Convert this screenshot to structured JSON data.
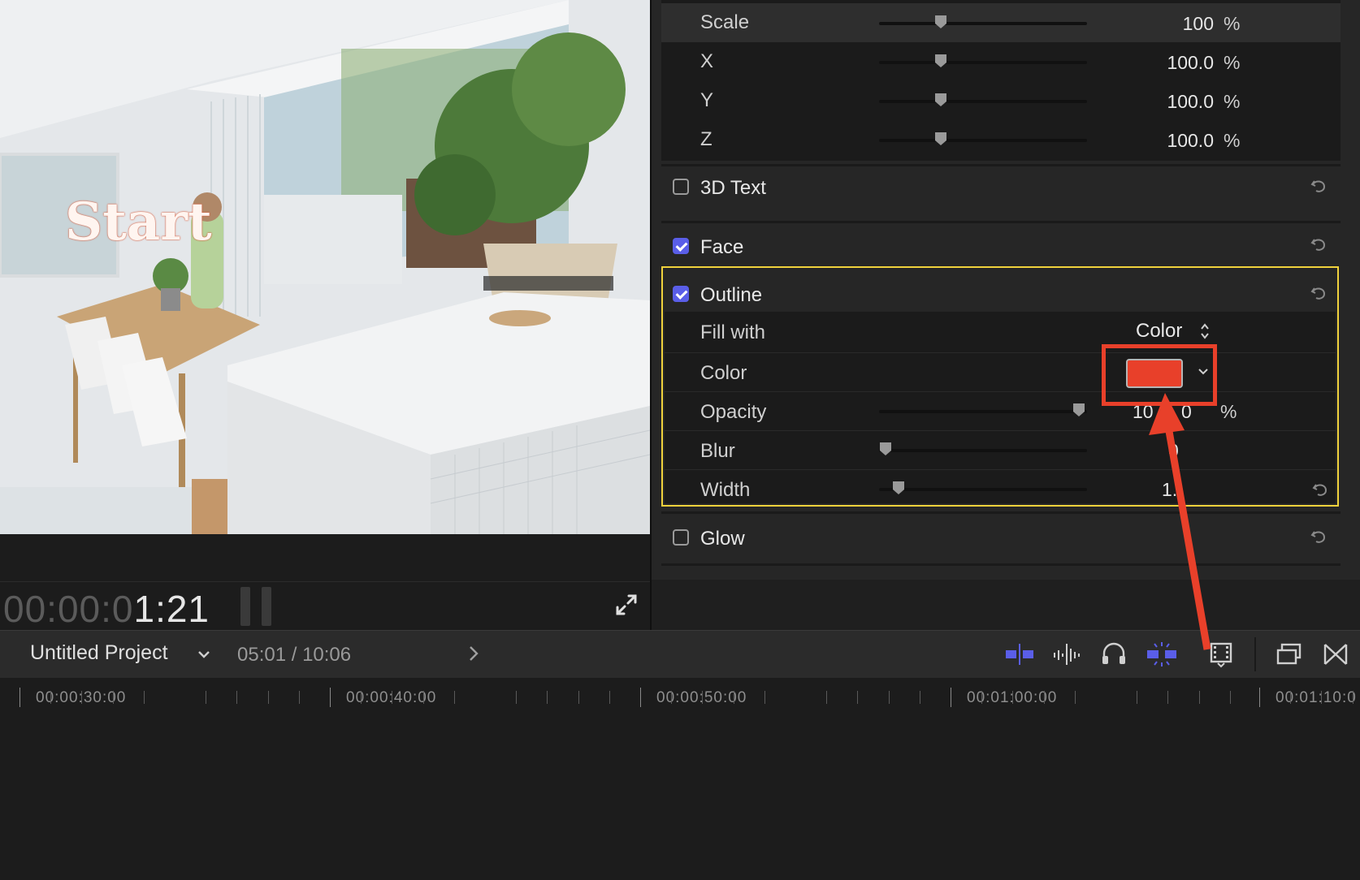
{
  "viewer": {
    "title_overlay": "Start",
    "timecode_dim": "00:00:0",
    "timecode_bright": "1:21"
  },
  "inspector": {
    "scale": {
      "label": "Scale",
      "value": "100",
      "unit": "%",
      "level": 0.27
    },
    "x": {
      "label": "X",
      "value": "100.0",
      "unit": "%",
      "level": 0.27
    },
    "y": {
      "label": "Y",
      "value": "100.0",
      "unit": "%",
      "level": 0.27
    },
    "z": {
      "label": "Z",
      "value": "100.0",
      "unit": "%",
      "level": 0.27
    },
    "text3d": {
      "label": "3D Text",
      "checked": false
    },
    "face": {
      "label": "Face",
      "checked": true
    },
    "outline": {
      "label": "Outline",
      "checked": true,
      "fill_with": {
        "label": "Fill with",
        "value": "Color"
      },
      "color": {
        "label": "Color",
        "swatch": "#e8402a"
      },
      "opacity": {
        "label": "Opacity",
        "value": "10",
        "value_tail": "0",
        "unit": "%",
        "level": 0.97
      },
      "blur": {
        "label": "Blur",
        "value": "0",
        "level": 0.0
      },
      "width": {
        "label": "Width",
        "value": "1.",
        "level": 0.06
      }
    },
    "glow": {
      "label": "Glow",
      "checked": false
    }
  },
  "timeline": {
    "project_name": "Untitled Project",
    "position": "05:01 / 10:06",
    "ruler_labels": [
      "00:00:30:00",
      "00:00:40:00",
      "00:00:50:00",
      "00:01:00:00",
      "00:01:10:0"
    ]
  },
  "colors": {
    "accent": "#5a5ee8",
    "highlight_box": "#f0d23c",
    "annotation_red": "#e8402a"
  }
}
